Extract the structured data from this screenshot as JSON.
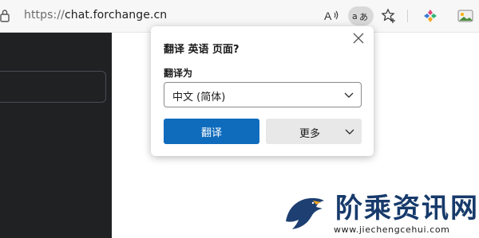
{
  "address_bar": {
    "url_protocol": "https://",
    "url_host": "chat.forchange.cn"
  },
  "toolbar_icons": [
    "read-aloud-icon",
    "translate-icon",
    "add-favorite-icon",
    "extensions-icon",
    "image-icon"
  ],
  "translate_popup": {
    "title": "翻译 英语 页面?",
    "target_label": "翻译为",
    "target_language": "中文 (简体)",
    "translate_button": "翻译",
    "more_button": "更多"
  },
  "watermark": {
    "brand": "阶乘资讯网",
    "domain": "www.jiechengcehui.com"
  },
  "colors": {
    "primary_button": "#0f6cbd",
    "dark_pane": "#202123",
    "watermark_text": "#173a6b"
  }
}
